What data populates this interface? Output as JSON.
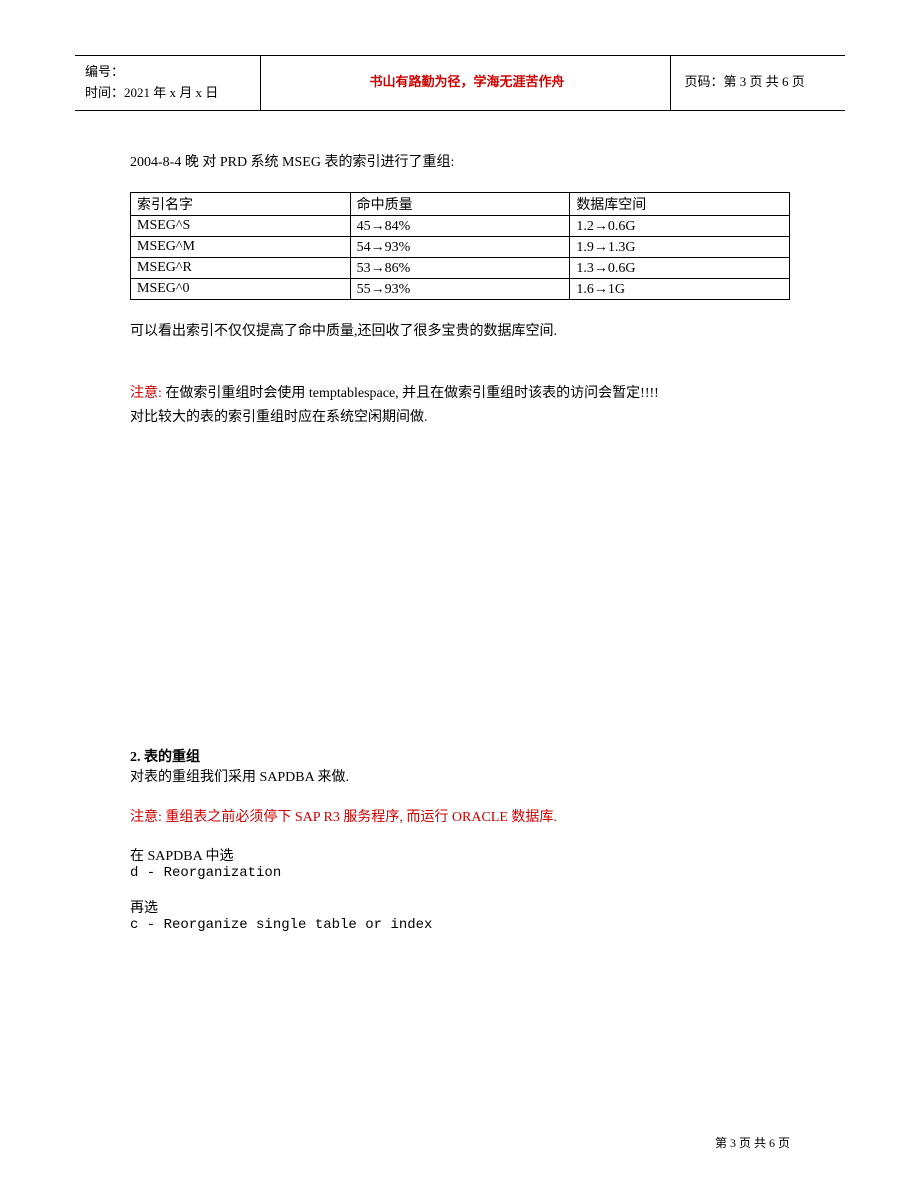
{
  "header": {
    "id_label": "编号：",
    "time_label": "时间：2021 年 x 月 x 日",
    "title": "书山有路勤为径，学海无涯苦作舟",
    "page_label": "页码：第 3 页  共 6 页"
  },
  "intro": "2004-8-4  晚  对 PRD  系统 MSEG 表的索引进行了重组:",
  "table": {
    "headers": {
      "col1": "索引名字",
      "col2": "命中质量",
      "col3": "数据库空间"
    },
    "rows": [
      {
        "name": "MSEG^S",
        "hit_from": "45",
        "hit_to": "84%",
        "space_from": "1.2",
        "space_to": "0.6G"
      },
      {
        "name": "MSEG^M",
        "hit_from": "54",
        "hit_to": "93%",
        "space_from": "1.9",
        "space_to": "1.3G"
      },
      {
        "name": "MSEG^R",
        "hit_from": "53",
        "hit_to": "86%",
        "space_from": "1.3",
        "space_to": "0.6G"
      },
      {
        "name": "MSEG^0",
        "hit_from": "55",
        "hit_to": "93%",
        "space_from": "1.6",
        "space_to": "1G"
      }
    ]
  },
  "after_table": "可以看出索引不仅仅提高了命中质量,还回收了很多宝贵的数据库空间.",
  "note1": {
    "label": "注意:",
    "line1": "  在做索引重组时会使用 temptablespace,  并且在做索引重组时该表的访问会暂定!!!!",
    "line2": "对比较大的表的索引重组时应在系统空闲期间做."
  },
  "section2": {
    "heading": "2. 表的重组",
    "line1": "对表的重组我们采用 SAPDBA 来做.",
    "note_label": "注意:",
    "note_text": "  重组表之前必须停下 SAP R3 服务程序, 而运行 ORACLE 数据库.",
    "step1_intro": "在 SAPDBA 中选",
    "step1_cmd": "d - Reorganization",
    "step2_intro": "再选",
    "step2_cmd": "c - Reorganize single table or index"
  },
  "footer": "第 3 页 共 6 页"
}
